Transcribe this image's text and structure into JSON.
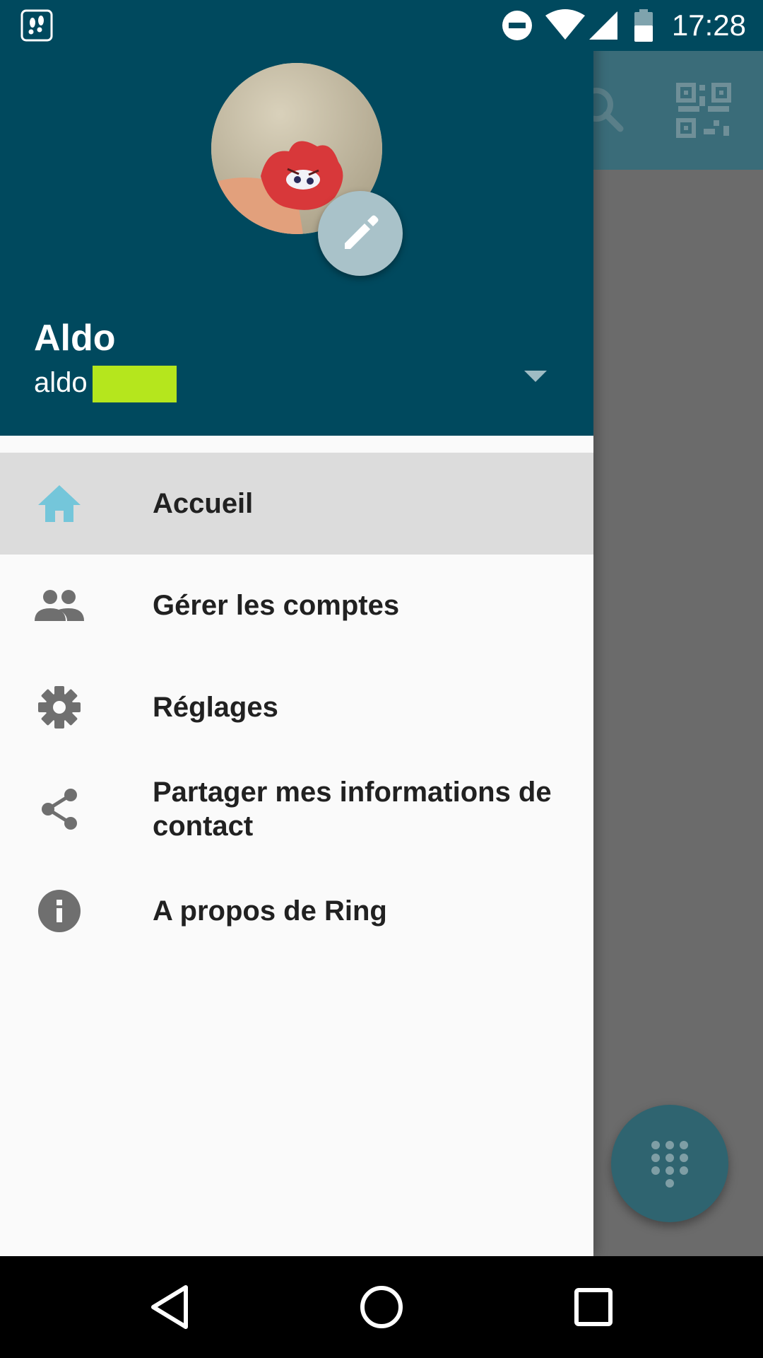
{
  "status_bar": {
    "time": "17:28",
    "icons": [
      "app-notification-icon",
      "do-not-disturb-icon",
      "wifi-icon",
      "cellular-signal-icon",
      "battery-icon"
    ]
  },
  "app_toolbar": {
    "icons": [
      "search-icon",
      "qr-code-icon"
    ],
    "color": "#3a6c79"
  },
  "drawer": {
    "header_color": "#00495e",
    "account_name": "Aldo",
    "account_id": "aldo",
    "menu": [
      {
        "label": "Accueil",
        "icon": "home-icon",
        "selected": true
      },
      {
        "label": "Gérer les comptes",
        "icon": "people-icon",
        "selected": false
      },
      {
        "label": "Réglages",
        "icon": "settings-icon",
        "selected": false
      },
      {
        "label": "Partager mes informations de contact",
        "icon": "share-icon",
        "selected": false
      },
      {
        "label": "A propos de Ring",
        "icon": "info-icon",
        "selected": false
      }
    ]
  },
  "fab": {
    "icon": "dialpad-icon"
  },
  "nav_bar": {
    "buttons": [
      "back-icon",
      "home-circle-icon",
      "recents-icon"
    ]
  },
  "colors": {
    "accent_home_icon": "#74c6da",
    "redaction": "#b5e61d",
    "selected_row": "#dcdcdc"
  }
}
